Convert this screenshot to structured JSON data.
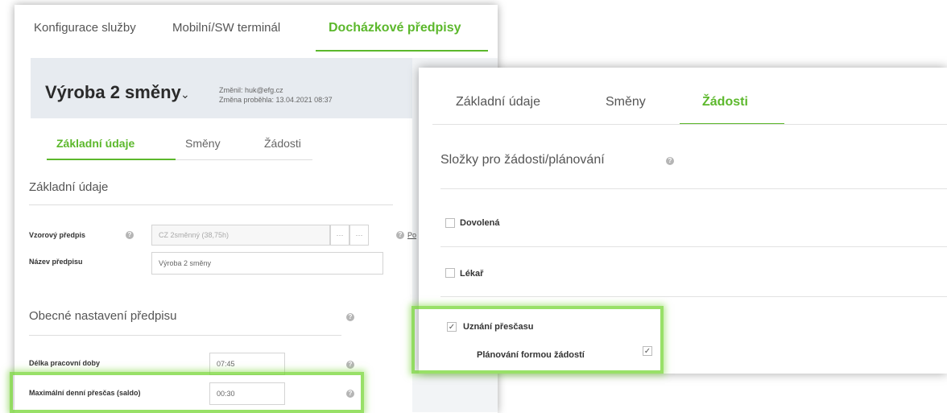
{
  "top_tabs": [
    {
      "label": "Konfigurace služby"
    },
    {
      "label": "Mobilní/SW terminál"
    },
    {
      "label": "Docházkové předpisy"
    }
  ],
  "header": {
    "title": "Výroba 2 směny",
    "changed_by": "Změnil: huk@efg.cz",
    "changed_at": "Změna proběhla: 13.04.2021 08:37"
  },
  "sub_tabs": [
    {
      "label": "Základní údaje"
    },
    {
      "label": "Směny"
    },
    {
      "label": "Žádosti"
    }
  ],
  "basic_section": {
    "title": "Základní údaje",
    "template_label": "Vzorový předpis",
    "template_value": "CZ 2směnný (38,75h)",
    "template_link": "Po",
    "name_label": "Název předpisu",
    "name_value": "Výroba 2 směny"
  },
  "general_section": {
    "title": "Obecné nastavení předpisu",
    "work_length_label": "Délka pracovní doby",
    "work_length_value": "07:45",
    "max_overtime_label": "Maximální denní přesčas (saldo)",
    "max_overtime_value": "00:30"
  },
  "front": {
    "tabs": [
      {
        "label": "Základní údaje"
      },
      {
        "label": "Směny"
      },
      {
        "label": "Žádosti"
      }
    ],
    "section_title": "Složky pro žádosti/plánování",
    "items": [
      {
        "label": "Dovolená",
        "checked": false
      },
      {
        "label": "Lékař",
        "checked": false
      },
      {
        "label": "Uznání přesčasu",
        "checked": true
      }
    ],
    "sub_option": {
      "label": "Plánování formou žádostí",
      "checked": true
    }
  },
  "icons": {
    "check": "✓",
    "dots": "···",
    "help": "?",
    "chevron": "⌄"
  },
  "colors": {
    "accent": "#5cb82c",
    "highlight": "#76d634"
  }
}
